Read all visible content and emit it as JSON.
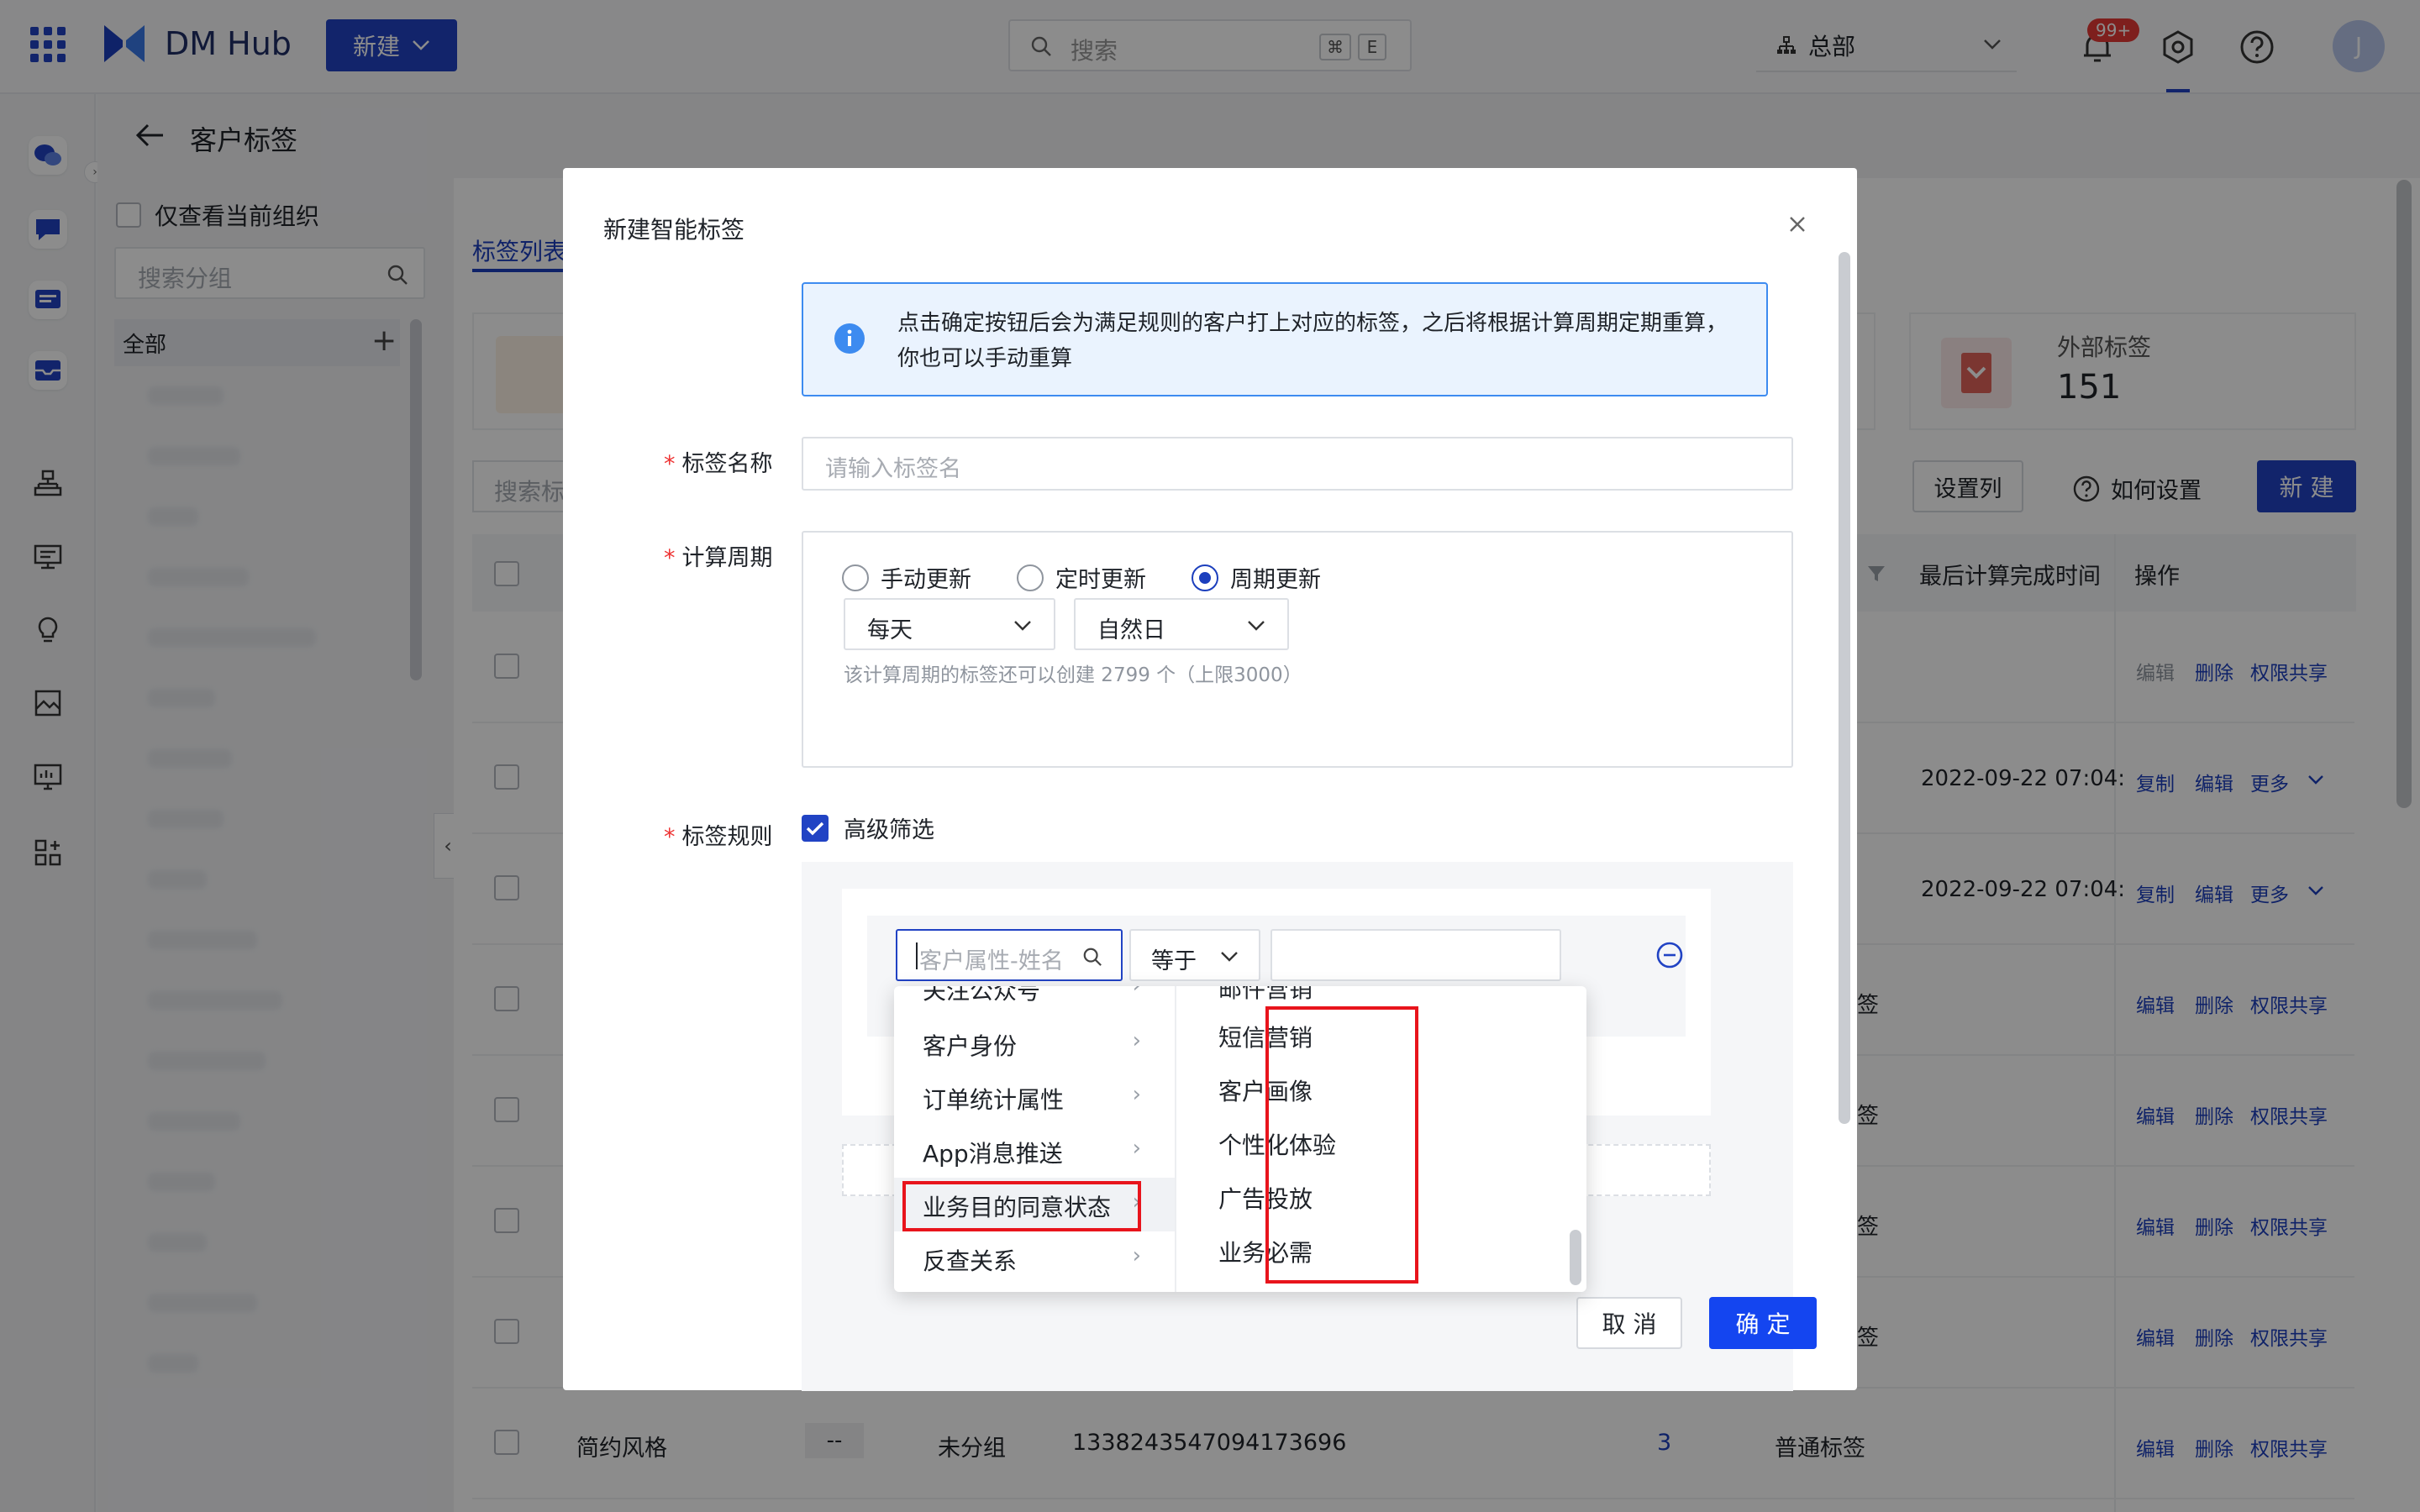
{
  "topbar": {
    "app_name": "DM Hub",
    "new_button": "新建",
    "search_placeholder": "搜索",
    "shortcut_cmd": "⌘",
    "shortcut_key": "E",
    "org": "总部",
    "notification_count": "99+",
    "avatar_initial": "J"
  },
  "page": {
    "title": "客户标签",
    "only_current_org": "仅查看当前组织",
    "group_search_placeholder": "搜索分组",
    "tree_all": "全部",
    "tab_list": "标签列表",
    "external_tags_label": "外部标签",
    "external_tags_count": "151",
    "tag_search_placeholder": "搜索标",
    "set_columns": "设置列",
    "how_to_set": "如何设置",
    "new_button": "新 建",
    "col_last_calc": "最后计算完成时间",
    "col_actions": "操作"
  },
  "table": {
    "rows": [
      {
        "name": "",
        "time": "",
        "suffix": "",
        "actions": [
          "编辑",
          "删除",
          "权限共享"
        ]
      },
      {
        "name": "",
        "time": "2022-09-22 07:04:",
        "suffix": "",
        "actions": [
          "复制",
          "编辑",
          "更多"
        ]
      },
      {
        "name": "",
        "time": "2022-09-22 07:04:",
        "suffix": "",
        "actions": [
          "复制",
          "编辑",
          "更多"
        ]
      },
      {
        "name": "",
        "time": "",
        "suffix": "签",
        "actions": [
          "编辑",
          "删除",
          "权限共享"
        ]
      },
      {
        "name": "",
        "time": "",
        "suffix": "签",
        "actions": [
          "编辑",
          "删除",
          "权限共享"
        ]
      },
      {
        "name": "",
        "time": "",
        "suffix": "签",
        "actions": [
          "编辑",
          "删除",
          "权限共享"
        ]
      },
      {
        "name": "",
        "time": "",
        "suffix": "签",
        "actions": [
          "编辑",
          "删除",
          "权限共享"
        ]
      }
    ],
    "last_row": {
      "name": "简约风格",
      "dash": "--",
      "group": "未分组",
      "id": "1338243547094173696",
      "count": "3",
      "type": "普通标签",
      "actions": [
        "编辑",
        "删除",
        "权限共享"
      ]
    }
  },
  "modal": {
    "title": "新建智能标签",
    "info_text": "点击确定按钮后会为满足规则的客户打上对应的标签，之后将根据计算周期定期重算，你也可以手动重算",
    "name_label": "标签名称",
    "name_placeholder": "请输入标签名",
    "period_label": "计算周期",
    "radio_manual": "手动更新",
    "radio_scheduled": "定时更新",
    "radio_periodic": "周期更新",
    "selected_radio": "周期更新",
    "period_value": "每天",
    "day_type": "自然日",
    "quota_hint": "该计算周期的标签还可以创建 2799 个（上限3000）",
    "rule_label": "标签规则",
    "advanced_filter": "高级筛选",
    "advanced_filter_checked": true,
    "attr_placeholder": "客户属性-姓名",
    "operator": "等于",
    "cancel": "取 消",
    "confirm": "确 定"
  },
  "cascader": {
    "left_partial": "关注公众号",
    "left_items": [
      "客户身份",
      "订单统计属性",
      "App消息推送",
      "业务目的同意状态",
      "反查关系"
    ],
    "left_highlighted": "业务目的同意状态",
    "right_partial": "邮件营销",
    "right_items": [
      "短信营销",
      "客户画像",
      "个性化体验",
      "广告投放",
      "业务必需"
    ]
  },
  "colors": {
    "primary": "#1c3fbd",
    "highlight_box": "#e8141c",
    "info_bg": "#eaf3fe",
    "info_border": "#3d8bf0"
  }
}
